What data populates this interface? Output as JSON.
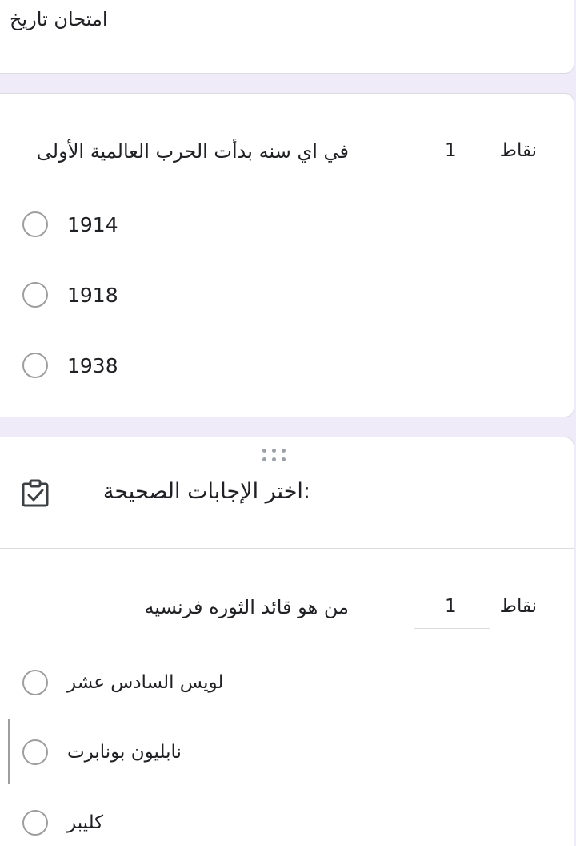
{
  "form": {
    "title": "امتحان تاريخ"
  },
  "question1": {
    "title": "في اي سنه بدأت الحرب العالمية الأولى",
    "points_label": "نقاط",
    "points_value": "1",
    "options": [
      "1914",
      "1918",
      "1938"
    ]
  },
  "section2": {
    "title": ":اختر الإجابات الصحيحة",
    "icon": "checklist-icon"
  },
  "question2": {
    "title": "من هو قائد الثوره فرنسيه",
    "points_label": "نقاط",
    "points_value": "1",
    "options": [
      "لويس السادس عشر",
      "نابليون بونابرت",
      "كليبر"
    ]
  },
  "colors": {
    "background": "#f0ebf8",
    "card": "#ffffff",
    "border": "#dadce0",
    "radio": "#9e9e9e",
    "text": "#202124"
  }
}
